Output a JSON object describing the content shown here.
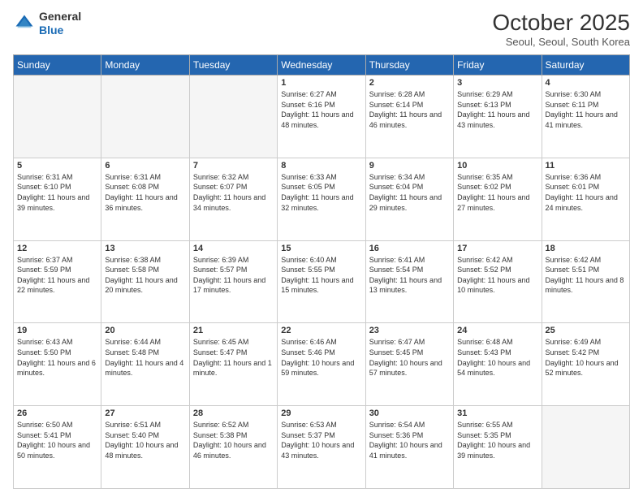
{
  "logo": {
    "general": "General",
    "blue": "Blue"
  },
  "header": {
    "month": "October 2025",
    "location": "Seoul, Seoul, South Korea"
  },
  "days_of_week": [
    "Sunday",
    "Monday",
    "Tuesday",
    "Wednesday",
    "Thursday",
    "Friday",
    "Saturday"
  ],
  "weeks": [
    [
      {
        "day": "",
        "empty": true
      },
      {
        "day": "",
        "empty": true
      },
      {
        "day": "",
        "empty": true
      },
      {
        "day": "1",
        "sunrise": "Sunrise: 6:27 AM",
        "sunset": "Sunset: 6:16 PM",
        "daylight": "Daylight: 11 hours and 48 minutes."
      },
      {
        "day": "2",
        "sunrise": "Sunrise: 6:28 AM",
        "sunset": "Sunset: 6:14 PM",
        "daylight": "Daylight: 11 hours and 46 minutes."
      },
      {
        "day": "3",
        "sunrise": "Sunrise: 6:29 AM",
        "sunset": "Sunset: 6:13 PM",
        "daylight": "Daylight: 11 hours and 43 minutes."
      },
      {
        "day": "4",
        "sunrise": "Sunrise: 6:30 AM",
        "sunset": "Sunset: 6:11 PM",
        "daylight": "Daylight: 11 hours and 41 minutes."
      }
    ],
    [
      {
        "day": "5",
        "sunrise": "Sunrise: 6:31 AM",
        "sunset": "Sunset: 6:10 PM",
        "daylight": "Daylight: 11 hours and 39 minutes."
      },
      {
        "day": "6",
        "sunrise": "Sunrise: 6:31 AM",
        "sunset": "Sunset: 6:08 PM",
        "daylight": "Daylight: 11 hours and 36 minutes."
      },
      {
        "day": "7",
        "sunrise": "Sunrise: 6:32 AM",
        "sunset": "Sunset: 6:07 PM",
        "daylight": "Daylight: 11 hours and 34 minutes."
      },
      {
        "day": "8",
        "sunrise": "Sunrise: 6:33 AM",
        "sunset": "Sunset: 6:05 PM",
        "daylight": "Daylight: 11 hours and 32 minutes."
      },
      {
        "day": "9",
        "sunrise": "Sunrise: 6:34 AM",
        "sunset": "Sunset: 6:04 PM",
        "daylight": "Daylight: 11 hours and 29 minutes."
      },
      {
        "day": "10",
        "sunrise": "Sunrise: 6:35 AM",
        "sunset": "Sunset: 6:02 PM",
        "daylight": "Daylight: 11 hours and 27 minutes."
      },
      {
        "day": "11",
        "sunrise": "Sunrise: 6:36 AM",
        "sunset": "Sunset: 6:01 PM",
        "daylight": "Daylight: 11 hours and 24 minutes."
      }
    ],
    [
      {
        "day": "12",
        "sunrise": "Sunrise: 6:37 AM",
        "sunset": "Sunset: 5:59 PM",
        "daylight": "Daylight: 11 hours and 22 minutes."
      },
      {
        "day": "13",
        "sunrise": "Sunrise: 6:38 AM",
        "sunset": "Sunset: 5:58 PM",
        "daylight": "Daylight: 11 hours and 20 minutes."
      },
      {
        "day": "14",
        "sunrise": "Sunrise: 6:39 AM",
        "sunset": "Sunset: 5:57 PM",
        "daylight": "Daylight: 11 hours and 17 minutes."
      },
      {
        "day": "15",
        "sunrise": "Sunrise: 6:40 AM",
        "sunset": "Sunset: 5:55 PM",
        "daylight": "Daylight: 11 hours and 15 minutes."
      },
      {
        "day": "16",
        "sunrise": "Sunrise: 6:41 AM",
        "sunset": "Sunset: 5:54 PM",
        "daylight": "Daylight: 11 hours and 13 minutes."
      },
      {
        "day": "17",
        "sunrise": "Sunrise: 6:42 AM",
        "sunset": "Sunset: 5:52 PM",
        "daylight": "Daylight: 11 hours and 10 minutes."
      },
      {
        "day": "18",
        "sunrise": "Sunrise: 6:42 AM",
        "sunset": "Sunset: 5:51 PM",
        "daylight": "Daylight: 11 hours and 8 minutes."
      }
    ],
    [
      {
        "day": "19",
        "sunrise": "Sunrise: 6:43 AM",
        "sunset": "Sunset: 5:50 PM",
        "daylight": "Daylight: 11 hours and 6 minutes."
      },
      {
        "day": "20",
        "sunrise": "Sunrise: 6:44 AM",
        "sunset": "Sunset: 5:48 PM",
        "daylight": "Daylight: 11 hours and 4 minutes."
      },
      {
        "day": "21",
        "sunrise": "Sunrise: 6:45 AM",
        "sunset": "Sunset: 5:47 PM",
        "daylight": "Daylight: 11 hours and 1 minute."
      },
      {
        "day": "22",
        "sunrise": "Sunrise: 6:46 AM",
        "sunset": "Sunset: 5:46 PM",
        "daylight": "Daylight: 10 hours and 59 minutes."
      },
      {
        "day": "23",
        "sunrise": "Sunrise: 6:47 AM",
        "sunset": "Sunset: 5:45 PM",
        "daylight": "Daylight: 10 hours and 57 minutes."
      },
      {
        "day": "24",
        "sunrise": "Sunrise: 6:48 AM",
        "sunset": "Sunset: 5:43 PM",
        "daylight": "Daylight: 10 hours and 54 minutes."
      },
      {
        "day": "25",
        "sunrise": "Sunrise: 6:49 AM",
        "sunset": "Sunset: 5:42 PM",
        "daylight": "Daylight: 10 hours and 52 minutes."
      }
    ],
    [
      {
        "day": "26",
        "sunrise": "Sunrise: 6:50 AM",
        "sunset": "Sunset: 5:41 PM",
        "daylight": "Daylight: 10 hours and 50 minutes."
      },
      {
        "day": "27",
        "sunrise": "Sunrise: 6:51 AM",
        "sunset": "Sunset: 5:40 PM",
        "daylight": "Daylight: 10 hours and 48 minutes."
      },
      {
        "day": "28",
        "sunrise": "Sunrise: 6:52 AM",
        "sunset": "Sunset: 5:38 PM",
        "daylight": "Daylight: 10 hours and 46 minutes."
      },
      {
        "day": "29",
        "sunrise": "Sunrise: 6:53 AM",
        "sunset": "Sunset: 5:37 PM",
        "daylight": "Daylight: 10 hours and 43 minutes."
      },
      {
        "day": "30",
        "sunrise": "Sunrise: 6:54 AM",
        "sunset": "Sunset: 5:36 PM",
        "daylight": "Daylight: 10 hours and 41 minutes."
      },
      {
        "day": "31",
        "sunrise": "Sunrise: 6:55 AM",
        "sunset": "Sunset: 5:35 PM",
        "daylight": "Daylight: 10 hours and 39 minutes."
      },
      {
        "day": "",
        "empty": true
      }
    ]
  ]
}
